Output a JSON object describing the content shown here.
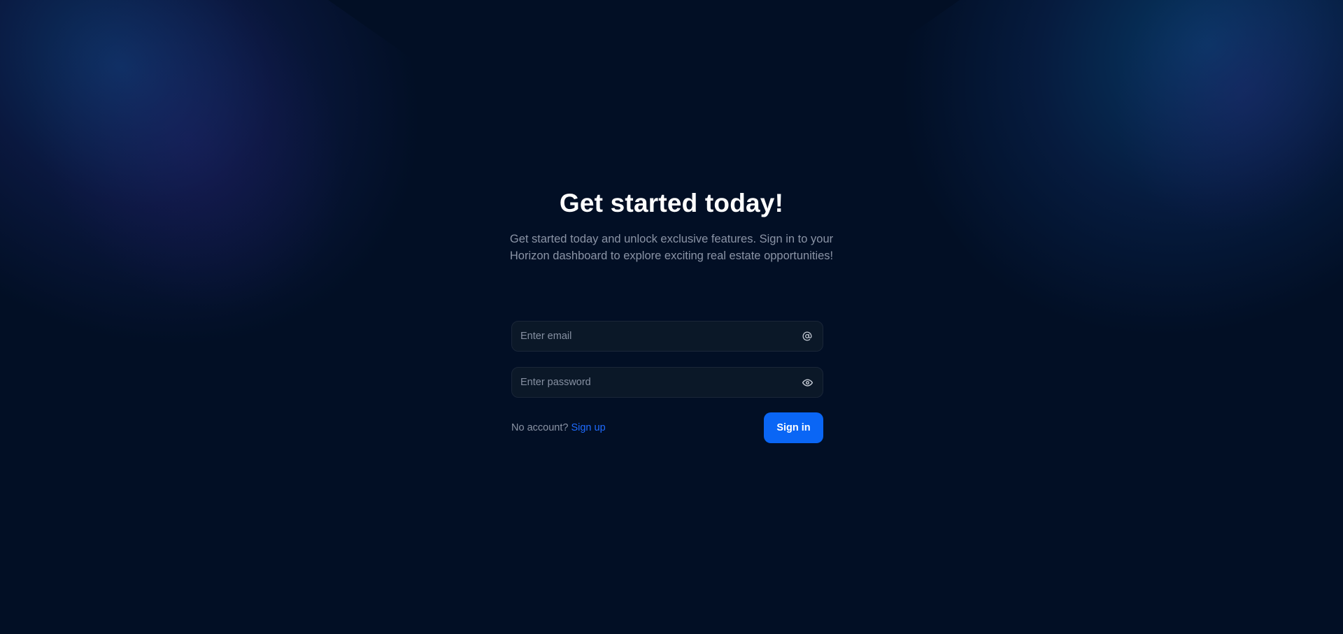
{
  "header": {
    "title": "Get started today!",
    "subtitle": "Get started today and unlock exclusive features. Sign in to your Horizon dashboard to explore exciting real estate opportunities!"
  },
  "form": {
    "email": {
      "placeholder": "Enter email",
      "value": "",
      "icon": "at-icon"
    },
    "password": {
      "placeholder": "Enter password",
      "value": "",
      "icon": "eye-icon"
    },
    "no_account_text": "No account?",
    "signup_label": "Sign up",
    "signin_label": "Sign in"
  },
  "colors": {
    "background": "#020f25",
    "accent": "#0a66f5",
    "link": "#1f6bff"
  }
}
